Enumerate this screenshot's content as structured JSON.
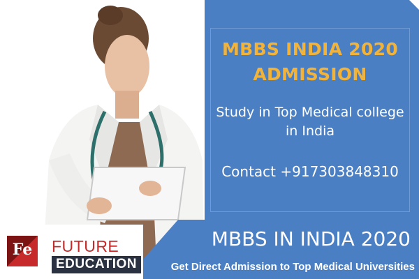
{
  "info_box": {
    "headline_line1": "MBBS INDIA 2020",
    "headline_line2": "ADMISSION",
    "subline1": "Study in Top Medical college",
    "subline2": "in India",
    "contact": "Contact +917303848310"
  },
  "logo": {
    "mark_letters": "Fe",
    "brand_line1": "FUTURE",
    "brand_line2": "EDUCATION"
  },
  "bottom_banner": {
    "title": "MBBS IN INDIA 2020",
    "tagline": "Get Direct Admission to Top Medical Universities"
  },
  "photo": {
    "subject": "doctor-using-tablet-photo"
  },
  "colors": {
    "accent_blue": "#4b7fc4",
    "headline_gold": "#f2b33a",
    "brand_red": "#c62a2a",
    "brand_dark": "#2a3140",
    "coat_white": "#f4f4f2"
  }
}
